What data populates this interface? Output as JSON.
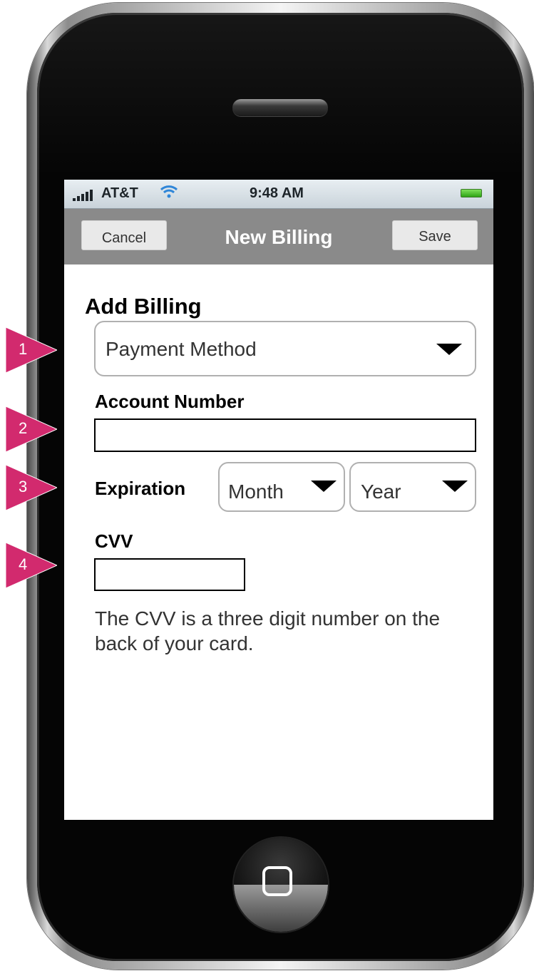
{
  "status_bar": {
    "carrier": "AT&T",
    "time": "9:48 AM"
  },
  "nav_bar": {
    "cancel_label": "Cancel",
    "title": "New Billing",
    "save_label": "Save"
  },
  "form": {
    "title": "Add Billing",
    "payment_method_value": "Payment Method",
    "account_number_label": "Account Number",
    "account_number_value": "",
    "expiration_label": "Expiration",
    "month_value": "Month",
    "year_value": "Year",
    "cvv_label": "CVV",
    "cvv_value": "",
    "cvv_help": "The CVV is a three digit number on the back of your card."
  },
  "callouts": [
    "1",
    "2",
    "3",
    "4"
  ],
  "colors": {
    "callout": "#d22a6e",
    "nav_bar": "#8a8a8a",
    "battery": "#2ea414"
  }
}
